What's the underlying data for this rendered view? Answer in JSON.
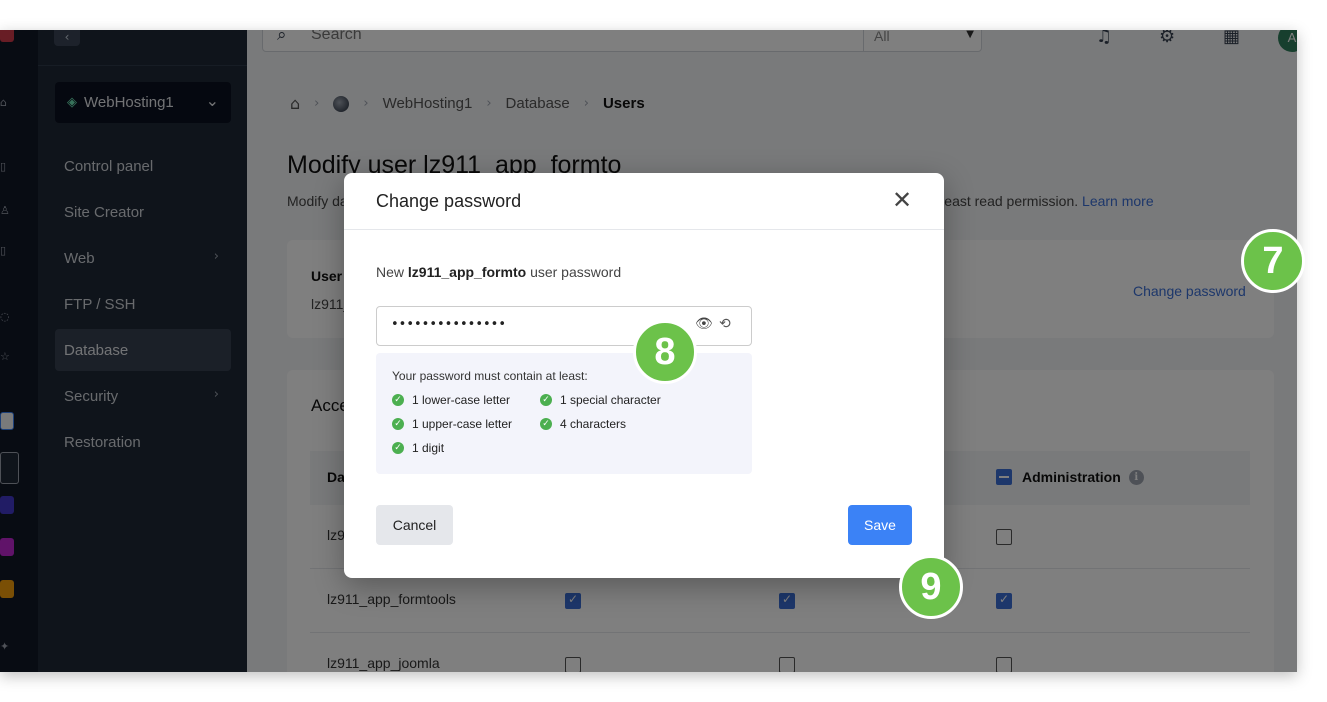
{
  "sidebar": {
    "site": "WebHosting1",
    "items": [
      {
        "label": "Control panel"
      },
      {
        "label": "Site Creator"
      },
      {
        "label": "Web"
      },
      {
        "label": "FTP / SSH"
      },
      {
        "label": "Database"
      },
      {
        "label": "Security"
      },
      {
        "label": "Restoration"
      }
    ],
    "active": "Database"
  },
  "topbar": {
    "search_placeholder": "Search",
    "scope": "All",
    "avatar": "A"
  },
  "breadcrumb": [
    "WebHosting1",
    "Database",
    "Users"
  ],
  "page": {
    "title": "Modify user lz911_app_formto",
    "description": "Modify database access permissions. To access the phpMyAdmin management tool, a user must have at least read permission.",
    "learn_more": "Learn more"
  },
  "user_card": {
    "label": "User",
    "value": "lz911_",
    "change_password": "Change password"
  },
  "access_card": {
    "title": "Acce",
    "col_database": "Da",
    "col_admin": "Administration",
    "rows": [
      {
        "name": "lz9"
      },
      {
        "name": "lz911_app_formtools"
      },
      {
        "name": "lz911_app_joomla"
      }
    ]
  },
  "modal": {
    "title": "Change password",
    "label_prefix": "New",
    "label_user": "lz911_app_formto",
    "label_suffix": "user password",
    "password_value": "•••••••••••••••",
    "requirements_head": "Your password must contain at least:",
    "requirements": [
      "1 lower-case letter",
      "1 special character",
      "1 upper-case letter",
      "4 characters",
      "1 digit"
    ],
    "cancel": "Cancel",
    "save": "Save"
  },
  "steps": [
    "7",
    "8",
    "9"
  ],
  "colors": {
    "accent": "#3b82f6",
    "link": "#3b6fd6",
    "step_badge": "#6cc24a",
    "check_ok": "#4caf50",
    "sidebar_bg": "#1f2937"
  }
}
